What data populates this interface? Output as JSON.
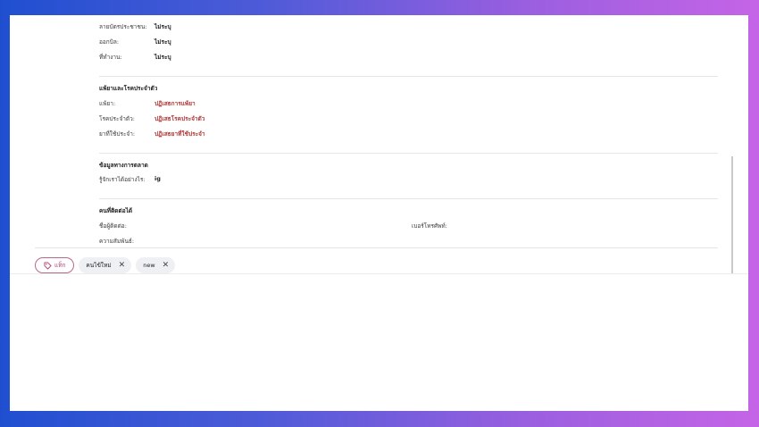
{
  "personal": {
    "rows": [
      {
        "label": "ลายบัตรประชาชน:",
        "value": "ไม่ระบุ"
      },
      {
        "label": "ออกบิล:",
        "value": "ไม่ระบุ"
      },
      {
        "label": "ที่ทำงาน:",
        "value": "ไม่ระบุ"
      }
    ]
  },
  "medical": {
    "title": "แพ้ยาและโรคประจำตัว",
    "rows": [
      {
        "label": "แพ้ยา:",
        "value": "ปฏิเสธการแพ้ยา"
      },
      {
        "label": "โรคประจำตัว:",
        "value": "ปฏิเสธโรคประจำตัว"
      },
      {
        "label": "ยาที่ใช้ประจำ:",
        "value": "ปฏิเสธยาที่ใช้ประจำ"
      }
    ]
  },
  "marketing": {
    "title": "ข้อมูลทางการตลาด",
    "rows": [
      {
        "label": "รู้จักเราได้อย่างไร:",
        "value": "ig"
      }
    ]
  },
  "contact": {
    "title": "คนที่ติดต่อได้",
    "name_label": "ชื่อผู้ติดต่อ:",
    "phone_label": "เบอร์โทรศัพท์:",
    "relation_label": "ความสัมพันธ์:"
  },
  "tags": {
    "add_label": "แท็ก",
    "chips": [
      "คนไข้ใหม่",
      "new"
    ]
  },
  "colors": {
    "accent_red": "#b03a3a",
    "tag_pink": "#b5406f"
  }
}
